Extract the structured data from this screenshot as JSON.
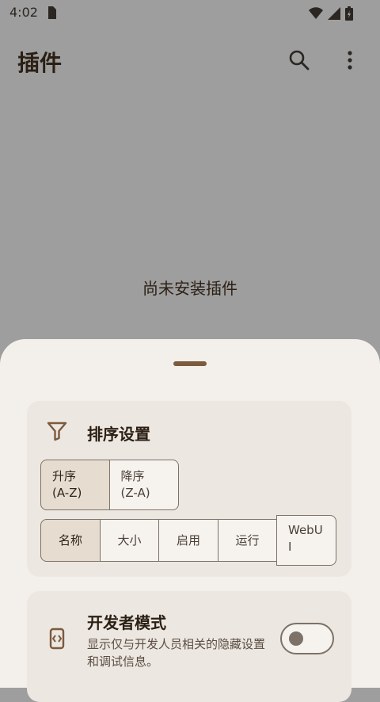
{
  "status_bar": {
    "time": "4:02"
  },
  "app_bar": {
    "title": "插件",
    "icons": [
      "search-icon",
      "more-vert-icon"
    ]
  },
  "empty_state": {
    "message": "尚未安装插件"
  },
  "sheet": {
    "sort_card": {
      "title": "排序设置",
      "icon": "filter-icon",
      "order_options": [
        {
          "label": "升序\n(A-Z)",
          "selected": true
        },
        {
          "label": "降序\n(Z-A)",
          "selected": false
        }
      ],
      "sort_options": [
        {
          "label": "名称",
          "selected": true
        },
        {
          "label": "大小",
          "selected": false
        },
        {
          "label": "启用",
          "selected": false
        },
        {
          "label": "运行",
          "selected": false
        },
        {
          "label": "WebUI",
          "selected": false
        }
      ]
    },
    "dev_card": {
      "title": "开发者模式",
      "icon": "developer-mode-icon",
      "description": "显示仅与开发人员相关的隐藏设置和调试信息。",
      "toggle_on": false
    }
  },
  "colors": {
    "scrim": "#9e9e9e",
    "sheet": "#f3efea",
    "card": "#ece7e1",
    "accent": "#7c5a3c",
    "selected": "#e6ddd0"
  }
}
